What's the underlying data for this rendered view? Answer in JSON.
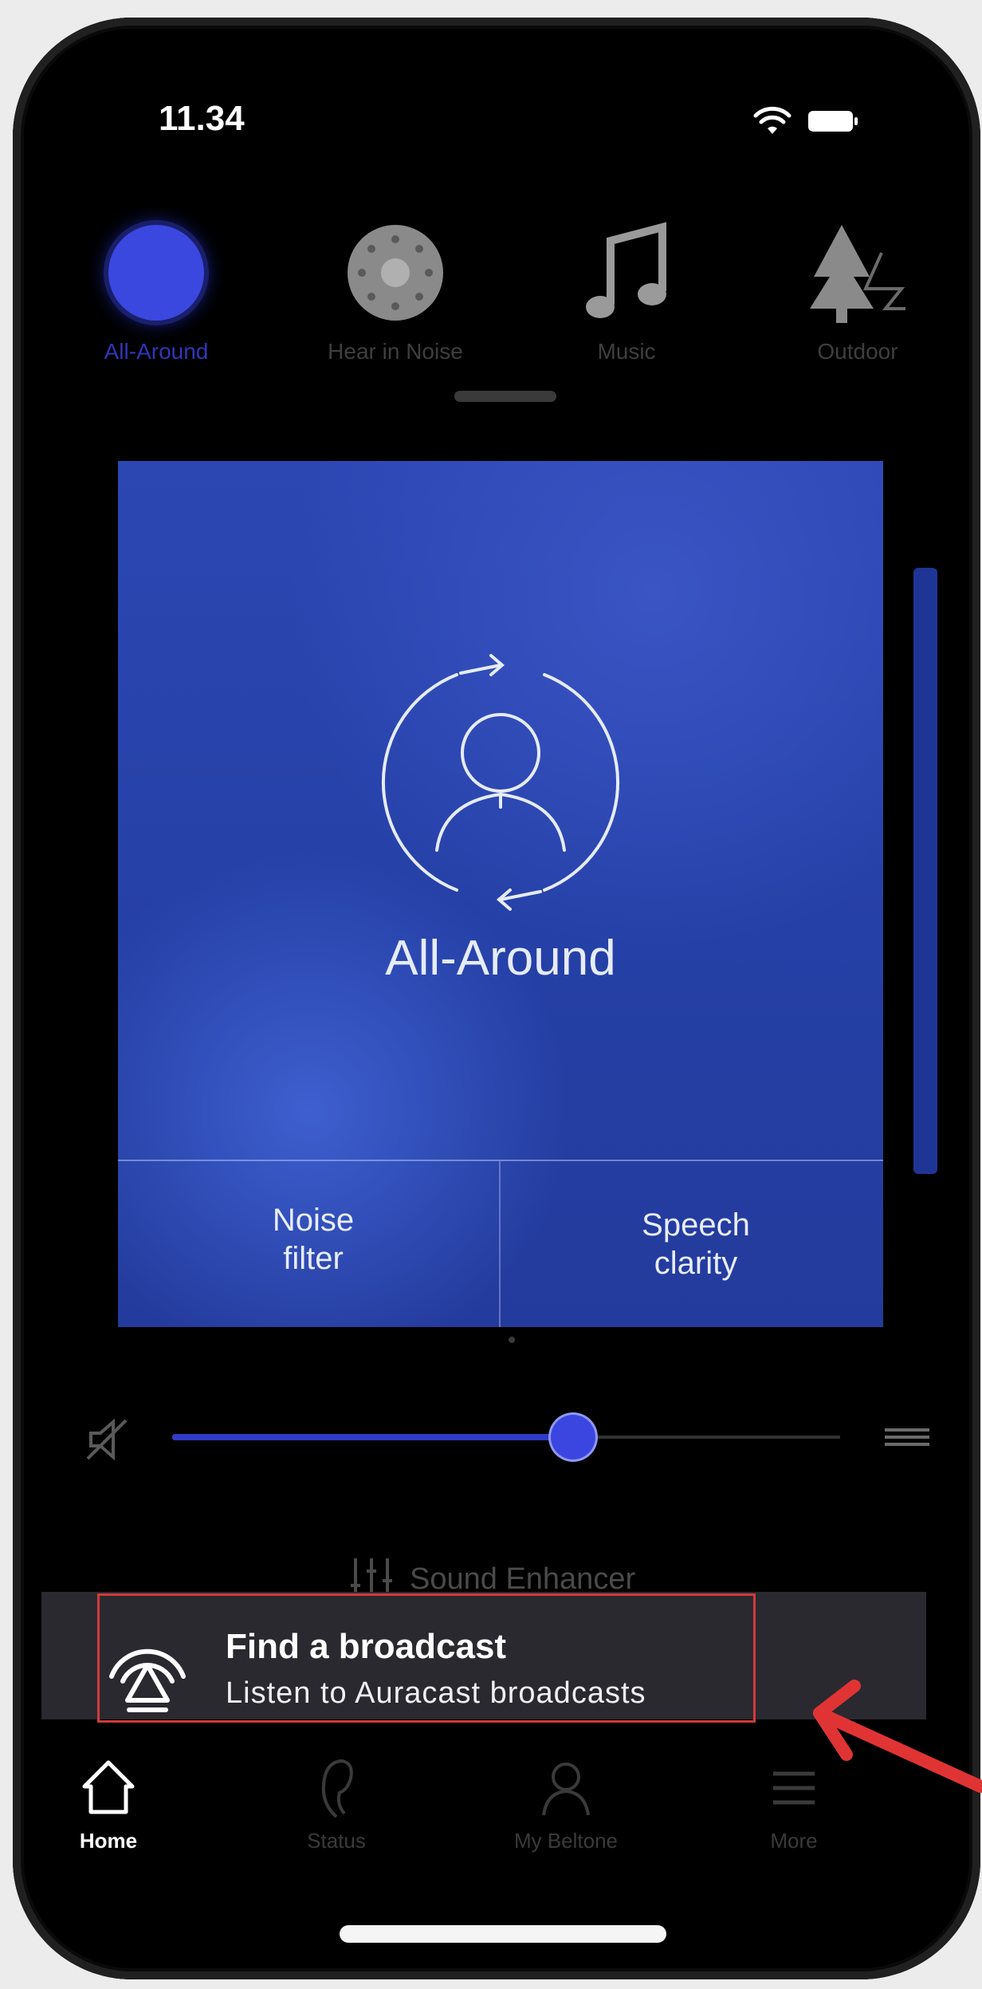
{
  "status_bar": {
    "time": "11.34"
  },
  "programs": [
    {
      "label": "All-Around",
      "icon": "all-around-icon",
      "active": true
    },
    {
      "label": "Hear in Noise",
      "icon": "hear-in-noise-icon",
      "active": false
    },
    {
      "label": "Music",
      "icon": "music-note-icon",
      "active": false
    },
    {
      "label": "Outdoor",
      "icon": "tree-icon",
      "active": false
    }
  ],
  "program_card": {
    "title": "All-Around",
    "noise_filter_line1": "Noise",
    "noise_filter_line2": "filter",
    "speech_clarity_line1": "Speech",
    "speech_clarity_line2": "clarity"
  },
  "volume": {
    "level_percent": 60
  },
  "sound_enhancer_label": "Sound Enhancer",
  "broadcast_banner": {
    "title": "Find a broadcast",
    "subtitle": "Listen to Auracast broadcasts"
  },
  "tabs": [
    {
      "label": "Home",
      "icon": "home-icon",
      "active": true
    },
    {
      "label": "Status",
      "icon": "hearing-aid-icon",
      "active": false
    },
    {
      "label": "My Beltone",
      "icon": "person-icon",
      "active": false
    },
    {
      "label": "More",
      "icon": "menu-icon",
      "active": false
    }
  ],
  "colors": {
    "accent": "#3a48e0",
    "card_blue": "#2a44ae",
    "banner_bg": "#2a2930",
    "annotation_red": "#d23a3a"
  }
}
